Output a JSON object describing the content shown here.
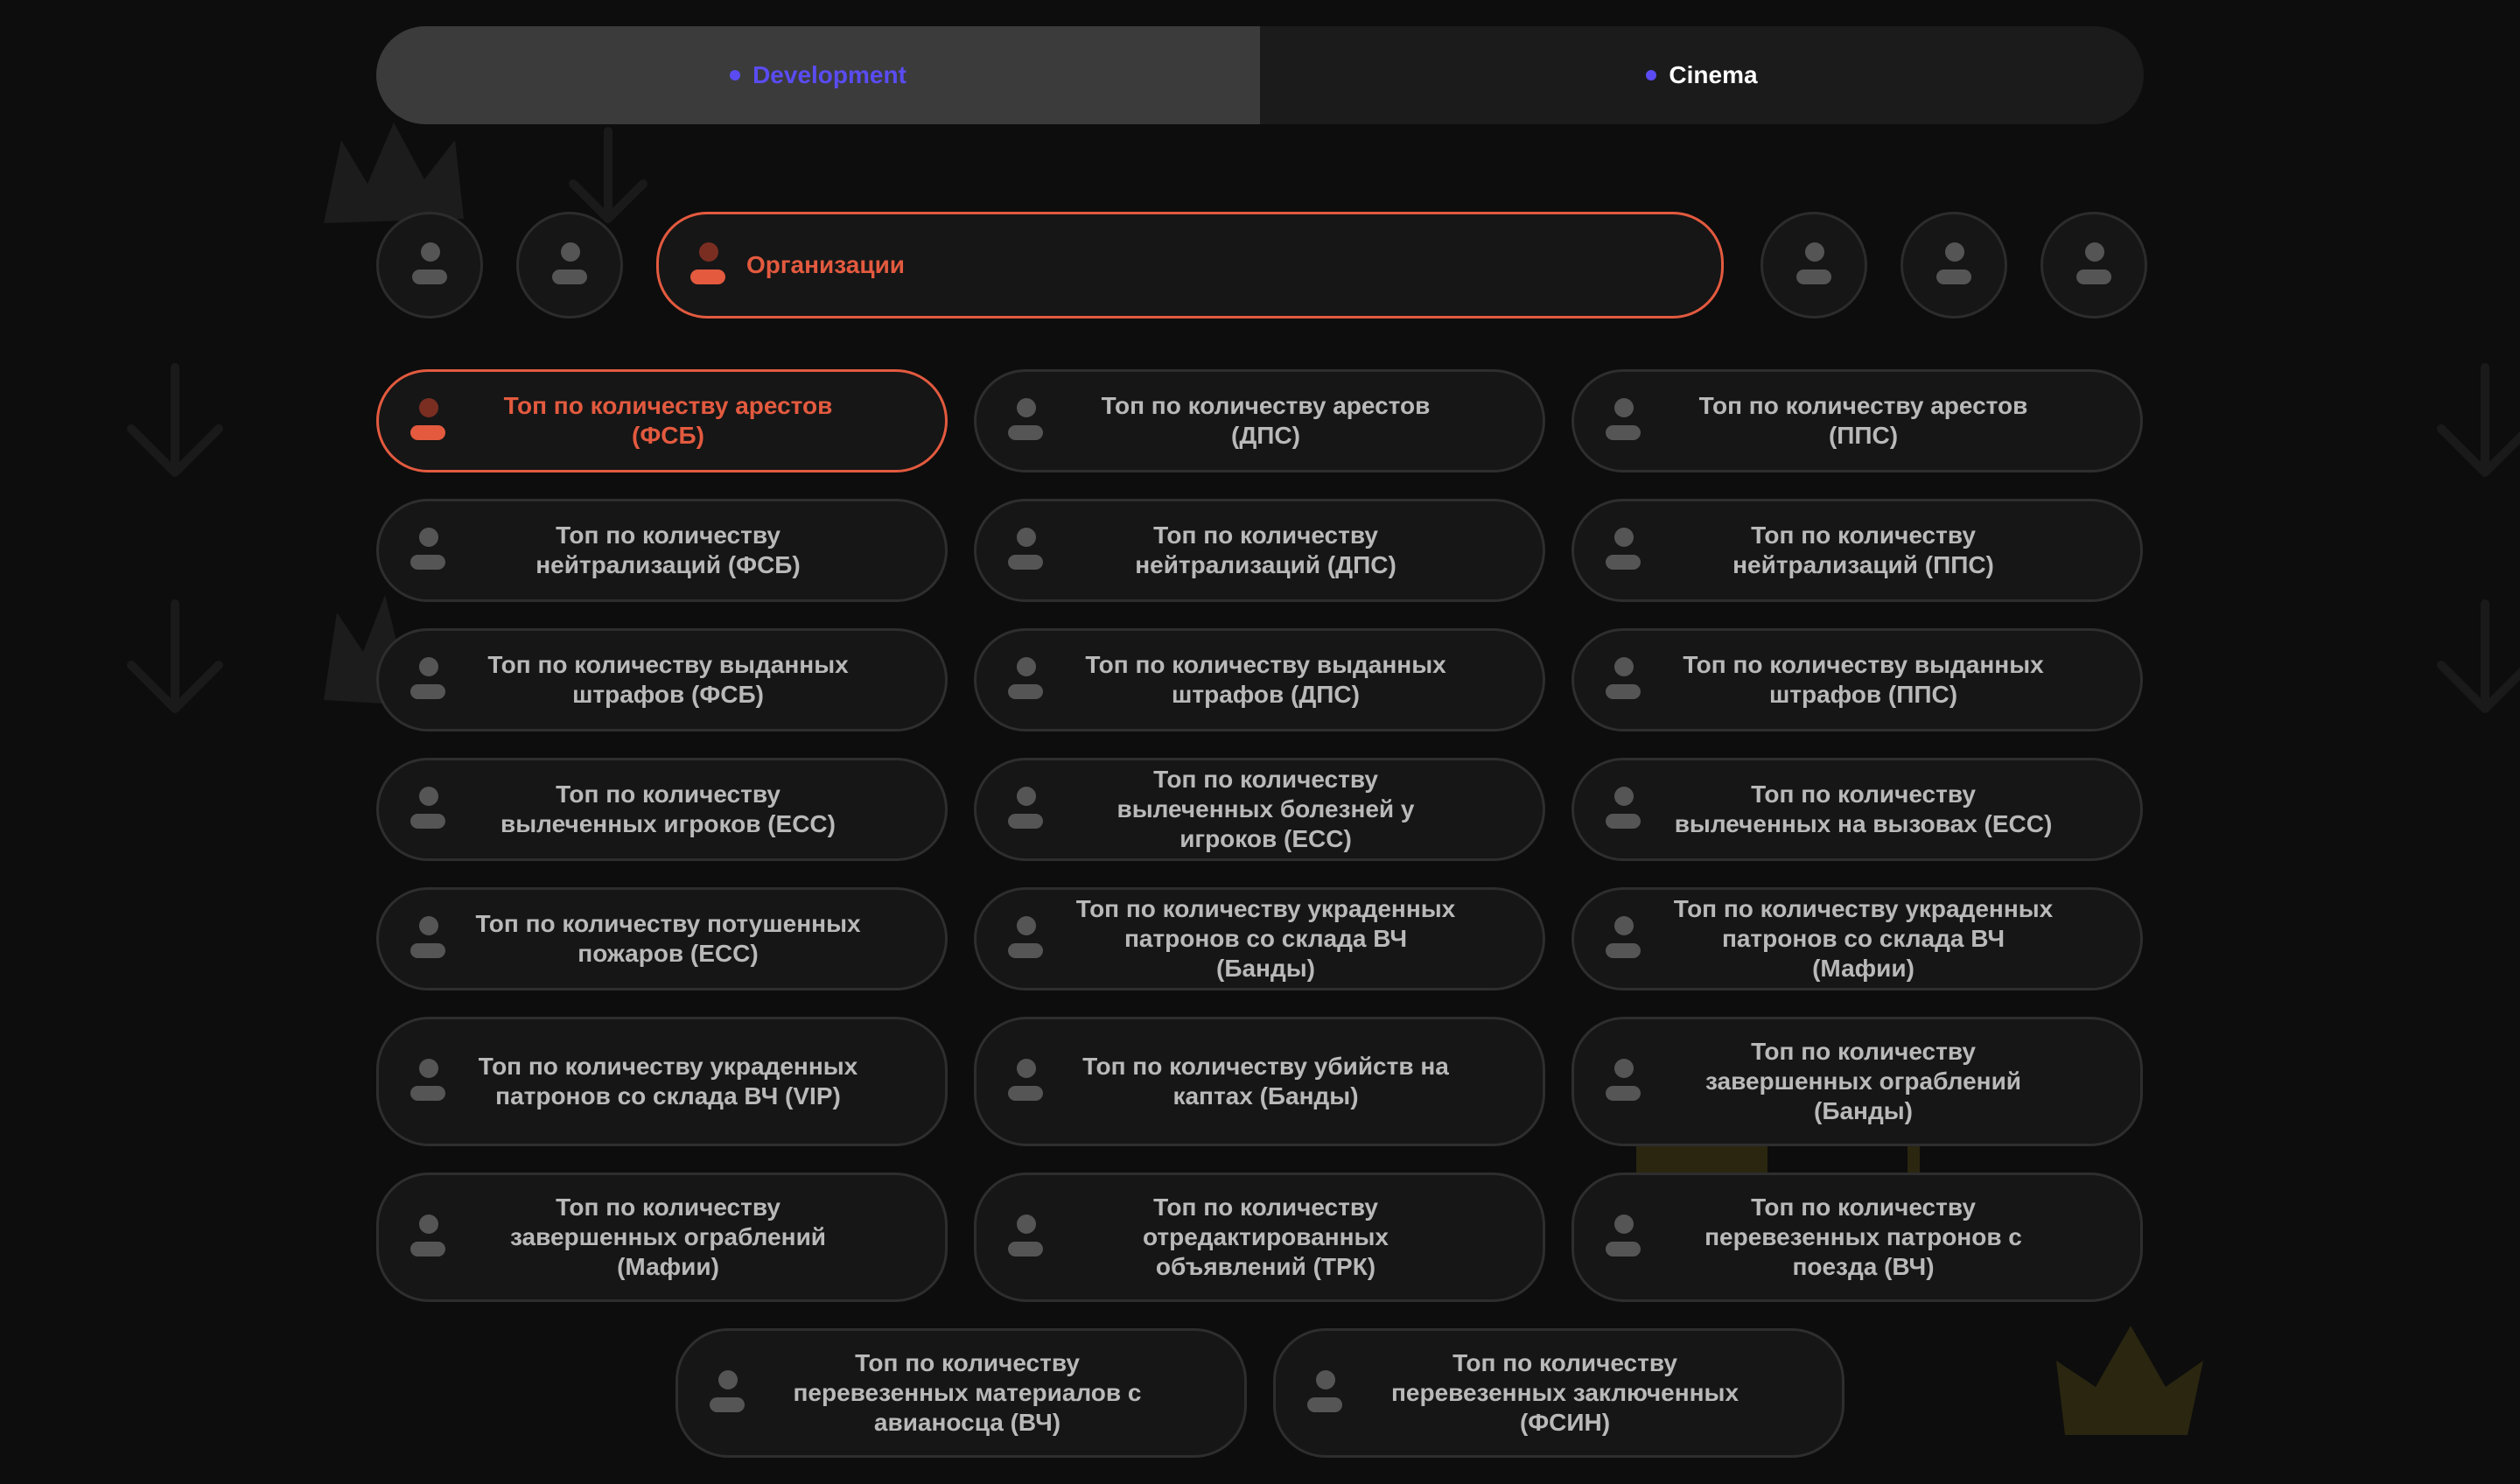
{
  "colors": {
    "background": "#0d0d0d",
    "accent": "#e35a3f",
    "server_accent": "#5a4cf2",
    "card_bg": "#161616",
    "card_border": "#2e2e2e",
    "card_text": "#b9b9b9"
  },
  "servers": {
    "items": [
      {
        "label": "Development",
        "active": true,
        "icon": "dot-icon"
      },
      {
        "label": "Cinema",
        "active": false,
        "icon": "dot-icon"
      }
    ]
  },
  "categories": {
    "selected_label": "Организации",
    "icon": "person-icon"
  },
  "rankings": {
    "rows": [
      [
        {
          "label": "Топ по количеству арестов (ФСБ)",
          "active": true
        },
        {
          "label": "Топ по количеству арестов (ДПС)",
          "active": false
        },
        {
          "label": "Топ по количеству арестов (ППС)",
          "active": false
        }
      ],
      [
        {
          "label": "Топ по количеству нейтрализаций (ФСБ)",
          "active": false
        },
        {
          "label": "Топ по количеству нейтрализаций (ДПС)",
          "active": false
        },
        {
          "label": "Топ по количеству нейтрализаций (ППС)",
          "active": false
        }
      ],
      [
        {
          "label": "Топ по количеству выданных штрафов (ФСБ)",
          "active": false
        },
        {
          "label": "Топ по количеству выданных штрафов (ДПС)",
          "active": false
        },
        {
          "label": "Топ по количеству выданных штрафов (ППС)",
          "active": false
        }
      ],
      [
        {
          "label": "Топ по количеству вылеченных игроков (ЕСС)",
          "active": false
        },
        {
          "label": "Топ по количеству вылеченных болезней у игроков (ЕСС)",
          "active": false
        },
        {
          "label": "Топ по количеству вылеченных на вызовах (ЕСС)",
          "active": false
        }
      ],
      [
        {
          "label": "Топ по количеству потушенных пожаров (ЕСС)",
          "active": false
        },
        {
          "label": "Топ по количеству украденных патронов со склада ВЧ (Банды)",
          "active": false
        },
        {
          "label": "Топ по количеству украденных патронов со склада ВЧ (Мафии)",
          "active": false
        }
      ],
      [
        {
          "label": "Топ по количеству украденных патронов со склада ВЧ (VIP)",
          "active": false
        },
        {
          "label": "Топ по количеству убийств на каптах (Банды)",
          "active": false
        },
        {
          "label": "Топ по количеству завершенных ограблений (Банды)",
          "active": false
        }
      ],
      [
        {
          "label": "Топ по количеству завершенных ограблений (Мафии)",
          "active": false
        },
        {
          "label": "Топ по количеству отредактированных объявлений (ТРК)",
          "active": false
        },
        {
          "label": "Топ по количеству перевезенных патронов с поезда (ВЧ)",
          "active": false
        }
      ],
      [
        {
          "label": "Топ по количеству перевезенных материалов с авианосца (ВЧ)",
          "active": false
        },
        {
          "label": "Топ по количеству перевезенных заключенных (ФСИН)",
          "active": false
        }
      ]
    ]
  }
}
